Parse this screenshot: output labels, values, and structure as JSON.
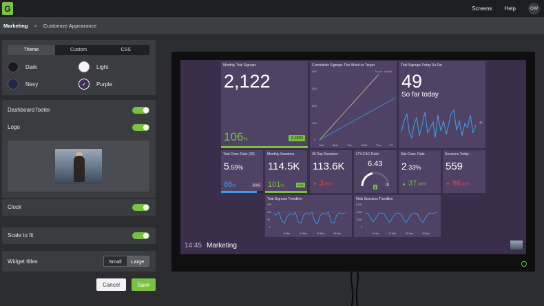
{
  "topbar": {
    "logo": "G",
    "screens": "Screens",
    "help": "Help",
    "user_initials": "OW"
  },
  "breadcrumb": {
    "parent": "Marketing",
    "separator": ">",
    "current": "Customize Appearance"
  },
  "tabs": {
    "theme": "Theme",
    "custom": "Custom",
    "css": "CSS"
  },
  "themes": {
    "dark": "Dark",
    "light": "Light",
    "navy": "Navy",
    "purple": "Purple",
    "selected": "Purple"
  },
  "settings": {
    "footer": "Dashboard footer",
    "logo": "Logo",
    "clock": "Clock",
    "scale": "Scale to fit",
    "widget_titles": "Widget titles",
    "small": "Small",
    "large": "Large"
  },
  "buttons": {
    "cancel": "Cancel",
    "save": "Save"
  },
  "colors": {
    "accent": "#7ac143",
    "screen_bg": "#3a2e4a",
    "widget_bg": "#4f4264",
    "positive": "#7ac143",
    "negative": "#e0444c",
    "blue": "#3d9be9"
  },
  "dashboard": {
    "footer_time": "14:45",
    "footer_name": "Marketing",
    "w1": {
      "title": "Monthly Trial Signups",
      "value": "2,122",
      "sub": "106",
      "sub_unit": "%",
      "badge": "2,000",
      "progress": 1.06
    },
    "w2": {
      "title": "Cumulative Signups This Week vs Target",
      "legend_target": "Target",
      "legend_actual": "Actual",
      "yticks": [
        "400",
        "300",
        "200",
        "100",
        "0"
      ],
      "xticks": [
        "Sun",
        "Mon",
        "Tue",
        "Wed",
        "Thu",
        "Fri"
      ]
    },
    "w3": {
      "title": "Trial Signups Today So Far",
      "value": "49",
      "sub": "So far today",
      "marker": "49"
    },
    "w4": {
      "title": "Trial Conv. Rate (35)",
      "value": "5",
      "value_dec": ".59%",
      "sub": "86",
      "sub_unit": "%",
      "badge": "6.5%",
      "progress": 0.86
    },
    "w5": {
      "title": "Monthly Sessions",
      "value": "114.5K",
      "sub": "101",
      "sub_unit": "%",
      "badge": "113K",
      "progress": 1.01
    },
    "w6": {
      "title": "30 Day Sessions",
      "value": "113.6K",
      "sub": "3",
      "sub_dec": ".99%"
    },
    "w7": {
      "title": "LTV:CAC Ratio",
      "value": "6.43",
      "min": "0",
      "max": "15",
      "target": "3",
      "gauge_value": 6.43,
      "gauge_max": 15
    },
    "w8": {
      "title": "Site Conv. Rate",
      "value": "2",
      "value_dec": ".33%",
      "sub": "37",
      "sub_dec": ".38%"
    },
    "w9": {
      "title": "Sessions Today",
      "value": "559",
      "sub": "86",
      "sub_dec": ".08%"
    },
    "w10": {
      "title": "Trial Signups Trendline",
      "yticks": [
        "150",
        "100",
        "50",
        "0"
      ],
      "xticks": [
        "6 Mar",
        "13 Mar",
        "20 Mar",
        "26 Mar"
      ]
    },
    "w11": {
      "title": "Web Sessions Trendline",
      "yticks": [
        "6,000",
        "4,000",
        "2,000",
        "0"
      ],
      "xticks": [
        "6 Mar",
        "13 Mar",
        "20 Mar",
        "26 Mar"
      ]
    }
  }
}
